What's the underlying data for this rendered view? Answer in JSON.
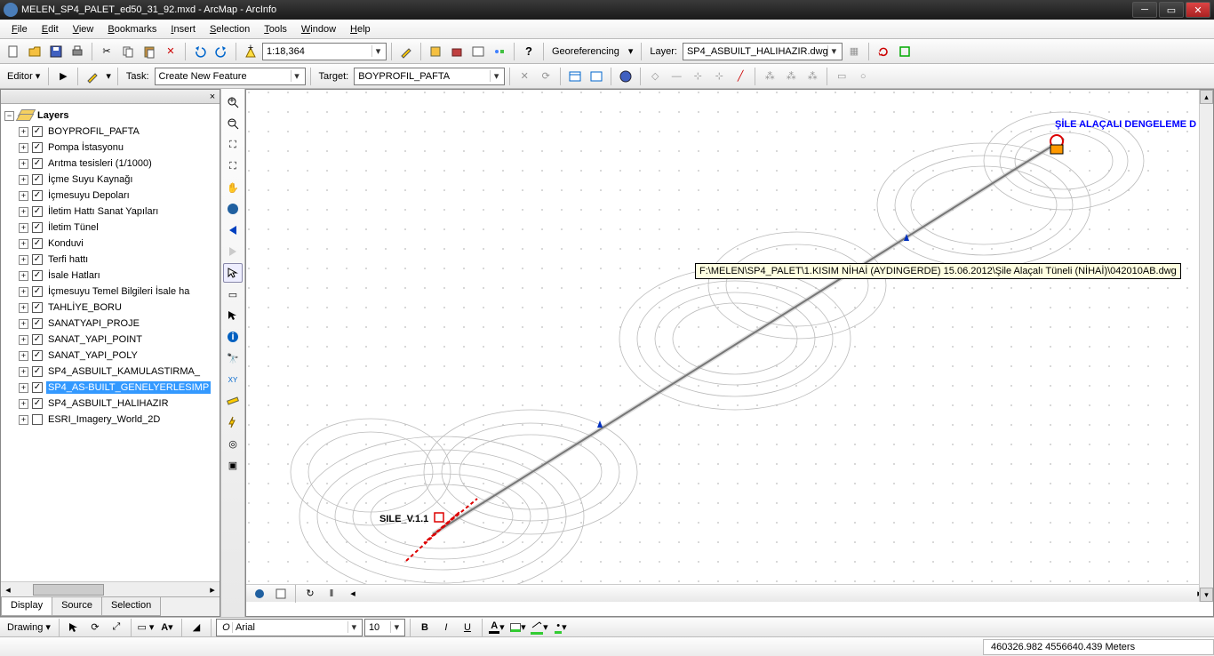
{
  "title": "MELEN_SP4_PALET_ed50_31_92.mxd - ArcMap - ArcInfo",
  "menus": [
    "File",
    "Edit",
    "View",
    "Bookmarks",
    "Insert",
    "Selection",
    "Tools",
    "Window",
    "Help"
  ],
  "scale": "1:18,364",
  "georef_label": "Georeferencing",
  "layer_label": "Layer:",
  "layer_value": "SP4_ASBUILT_HALIHAZIR.dwg A",
  "editor_label": "Editor",
  "task_label": "Task:",
  "task_value": "Create New Feature",
  "target_label": "Target:",
  "target_value": "BOYPROFIL_PAFTA",
  "toc_root": "Layers",
  "layers": [
    {
      "label": "BOYPROFIL_PAFTA",
      "checked": true
    },
    {
      "label": "Pompa İstasyonu",
      "checked": true
    },
    {
      "label": "Arıtma tesisleri (1/1000)",
      "checked": true
    },
    {
      "label": "İçme Suyu Kaynağı",
      "checked": true
    },
    {
      "label": "İçmesuyu Depoları",
      "checked": true
    },
    {
      "label": "İletim Hattı Sanat Yapıları",
      "checked": true
    },
    {
      "label": "İletim Tünel",
      "checked": true
    },
    {
      "label": "Konduvi",
      "checked": true
    },
    {
      "label": "Terfi hattı",
      "checked": true
    },
    {
      "label": "İsale Hatları",
      "checked": true
    },
    {
      "label": "İçmesuyu Temel Bilgileri İsale ha",
      "checked": true
    },
    {
      "label": "TAHLİYE_BORU",
      "checked": true
    },
    {
      "label": "SANATYAPI_PROJE",
      "checked": true
    },
    {
      "label": "SANAT_YAPI_POINT",
      "checked": true
    },
    {
      "label": "SANAT_YAPI_POLY",
      "checked": true
    },
    {
      "label": "SP4_ASBUILT_KAMULASTIRMA_",
      "checked": true
    },
    {
      "label": "SP4_AS-BUILT_GENELYERLESIMP",
      "checked": true,
      "selected": true
    },
    {
      "label": "SP4_ASBUILT_HALIHAZIR",
      "checked": true
    },
    {
      "label": "ESRI_Imagery_World_2D",
      "checked": false
    }
  ],
  "toc_tabs": {
    "display": "Display",
    "source": "Source",
    "selection": "Selection"
  },
  "tooltip_text": "F:\\MELEN\\SP4_PALET\\1.KISIM NİHAİ (AYDINGERDE) 15.06.2012\\Şile Alaçalı Tüneli (NİHAİ)\\042010AB.dwg",
  "map_label1": "SILE_V.1.1",
  "map_label2": "ŞİLE ALAÇALI DENGELEME D",
  "drawing_label": "Drawing",
  "font_name": "Arial",
  "font_size": "10",
  "coords": "460326.982 4556640.439 Meters",
  "icons": {
    "new": "new-icon",
    "open": "open-icon",
    "save": "save-icon",
    "print": "print-icon",
    "cut": "cut-icon",
    "copy": "copy-icon",
    "paste": "paste-icon",
    "delete": "delete-icon",
    "undo": "undo-icon",
    "redo": "redo-icon"
  }
}
